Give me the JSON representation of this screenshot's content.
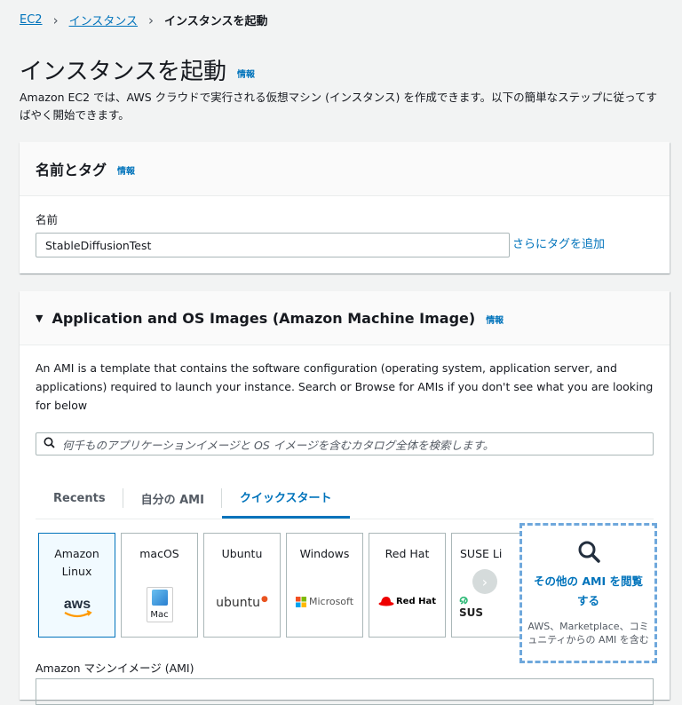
{
  "breadcrumb": {
    "items": [
      "EC2",
      "インスタンス"
    ],
    "current": "インスタンスを起動"
  },
  "page": {
    "title": "インスタンスを起動",
    "info": "情報",
    "description": "Amazon EC2 では、AWS クラウドで実行される仮想マシン (インスタンス) を作成できます。以下の簡単なステップに従ってすばやく開始できます。"
  },
  "name_tags": {
    "heading": "名前とタグ",
    "info": "情報",
    "name_label": "名前",
    "name_value": "StableDiffusionTest",
    "add_tag": "さらにタグを追加"
  },
  "ami": {
    "heading": "Application and OS Images (Amazon Machine Image)",
    "info": "情報",
    "description": "An AMI is a template that contains the software configuration (operating system, application server, and applications) required to launch your instance. Search or Browse for AMIs if you don't see what you are looking for below",
    "search_placeholder": "何千ものアプリケーションイメージと OS イメージを含むカタログ全体を検索します。",
    "tabs": [
      "Recents",
      "自分の AMI",
      "クイックスタート"
    ],
    "tiles": [
      {
        "name": "Amazon Linux",
        "logo": "aws"
      },
      {
        "name": "macOS",
        "logo": "Mac"
      },
      {
        "name": "Ubuntu",
        "logo": "ubuntu"
      },
      {
        "name": "Windows",
        "logo": "Microsoft"
      },
      {
        "name": "Red Hat",
        "logo": "Red Hat"
      },
      {
        "name": "SUSE Li",
        "logo": "SUS"
      }
    ],
    "browse_title": "その他の AMI を閲覧する",
    "browse_sub": "AWS、Marketplace、コミュニティからの AMI を含む",
    "ami_label": "Amazon マシンイメージ (AMI)"
  },
  "colors": {
    "link": "#0073bb",
    "aws_orange": "#ff9900",
    "ubuntu": "#e95420",
    "redhat": "#ee0000"
  }
}
